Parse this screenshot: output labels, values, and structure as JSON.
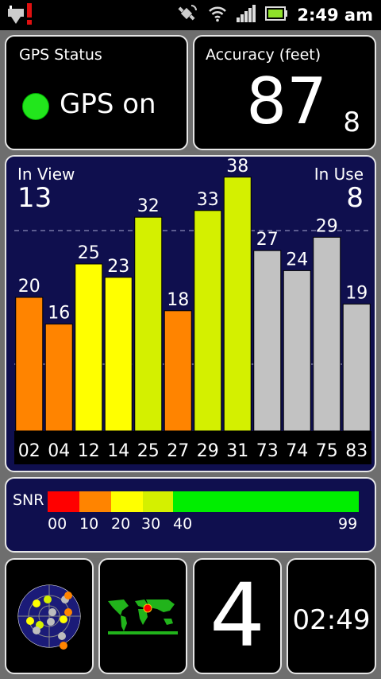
{
  "status_bar": {
    "time": "2:49 am",
    "icons": [
      "usb-debug-warning-icon",
      "gps-icon",
      "wifi-icon",
      "signal-icon",
      "battery-icon"
    ]
  },
  "gps_status": {
    "title": "GPS Status",
    "state": "GPS on",
    "dot_color": "#22e61c"
  },
  "accuracy": {
    "title": "Accuracy (feet)",
    "value": "87",
    "decimal": "8"
  },
  "satellites": {
    "in_view_label": "In View",
    "in_view": "13",
    "in_use_label": "In Use",
    "in_use": "8"
  },
  "chart_data": {
    "type": "bar",
    "categories": [
      "02",
      "04",
      "12",
      "14",
      "25",
      "27",
      "29",
      "31",
      "73",
      "74",
      "75",
      "83"
    ],
    "values": [
      20,
      16,
      25,
      23,
      32,
      18,
      33,
      38,
      27,
      24,
      29,
      19
    ],
    "colors": [
      "#ff8400",
      "#ff8400",
      "#ffff00",
      "#ffff00",
      "#d4f000",
      "#ff8400",
      "#d4f000",
      "#d4f000",
      "#c2c2c2",
      "#c2c2c2",
      "#c2c2c2",
      "#c2c2c2"
    ],
    "ylim": [
      0,
      50
    ],
    "gridlines": [
      10,
      30,
      50
    ]
  },
  "snr": {
    "label": "SNR",
    "scale": [
      {
        "from": 0,
        "to": 10,
        "color": "#ff0000"
      },
      {
        "from": 10,
        "to": 20,
        "color": "#ff8400"
      },
      {
        "from": 20,
        "to": 30,
        "color": "#ffff00"
      },
      {
        "from": 30,
        "to": 40,
        "color": "#d4f000"
      },
      {
        "from": 40,
        "to": 99,
        "color": "#00ee00"
      }
    ],
    "ticks": [
      "00",
      "10",
      "20",
      "30",
      "40",
      "99"
    ]
  },
  "widgets": {
    "number": "4",
    "clock": "02:49",
    "sky_icon": "sky-plot-icon",
    "map_icon": "world-map-icon"
  }
}
